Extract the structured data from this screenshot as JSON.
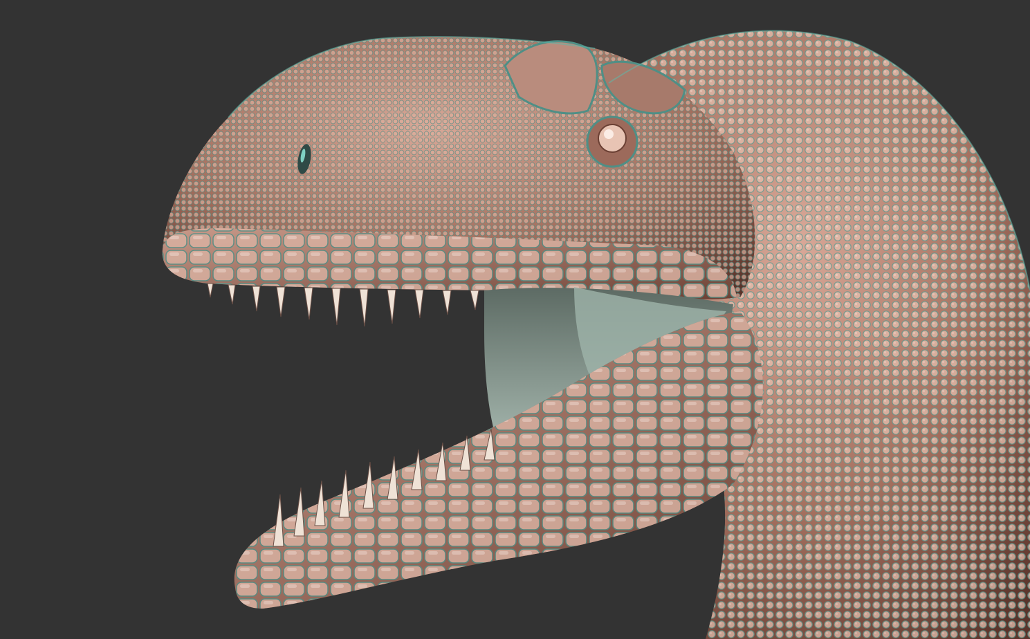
{
  "scene": {
    "subject": "dinosaur-head-sculpt",
    "colors": {
      "background": "#333333",
      "skin_light": "#e8c4b4",
      "skin_mid": "#b9806e",
      "skin_dark": "#6e3f33",
      "rim_teal": "#5fb8aa",
      "mouth_interior": "#8a9a92",
      "tooth": "#efe2d6"
    }
  }
}
